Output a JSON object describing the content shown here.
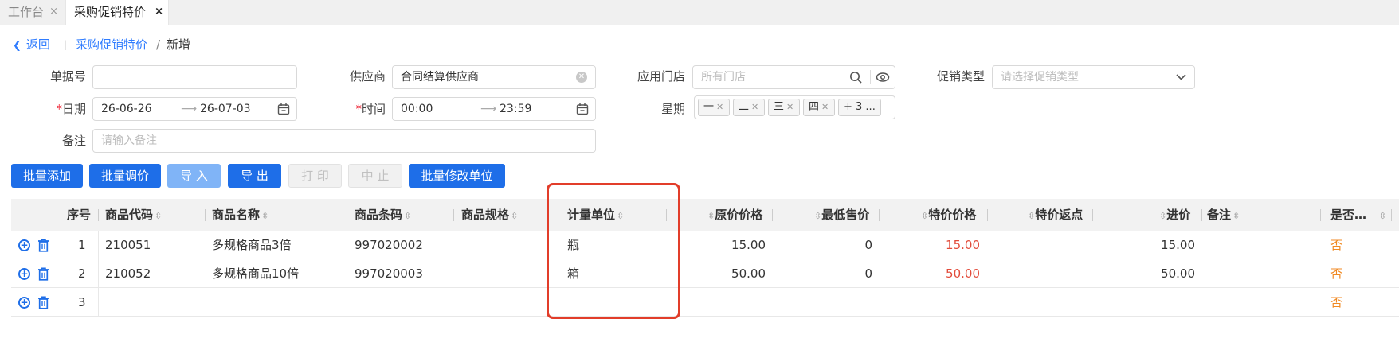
{
  "tabs": [
    {
      "label": "工作台",
      "close": "×"
    },
    {
      "label": "采购促销特价",
      "close": "×"
    }
  ],
  "breadcrumb": {
    "back": "返回",
    "sep": "|",
    "parent": "采购促销特价",
    "slash": "/",
    "current": "新增"
  },
  "form": {
    "doc_no": {
      "label": "单据号",
      "value": ""
    },
    "supplier": {
      "label": "供应商",
      "value": "合同结算供应商"
    },
    "store": {
      "label": "应用门店",
      "placeholder": "所有门店"
    },
    "promo_type": {
      "label": "促销类型",
      "placeholder": "请选择促销类型"
    },
    "date": {
      "required": "*",
      "label": "日期",
      "from": "26-06-26",
      "to": "26-07-03"
    },
    "time": {
      "required": "*",
      "label": "时间",
      "from": "00:00",
      "to": "23:59"
    },
    "weekday": {
      "label": "星期",
      "tags": [
        "一",
        "二",
        "三",
        "四"
      ],
      "more": "+ 3 ..."
    },
    "remark": {
      "label": "备注",
      "placeholder": "请输入备注"
    }
  },
  "buttons": {
    "batch_add": "批量添加",
    "batch_price": "批量调价",
    "import": "导 入",
    "export": "导 出",
    "print": "打 印",
    "stop": "中 止",
    "batch_unit": "批量修改单位"
  },
  "table": {
    "headers": {
      "seq": "序号",
      "code": "商品代码",
      "name": "商品名称",
      "barcode": "商品条码",
      "spec": "商品规格",
      "unit": "计量单位",
      "orig_price": "原价价格",
      "min_price": "最低售价",
      "special_price": "特价价格",
      "rebate": "特价返点",
      "cost": "进价",
      "note": "备注",
      "flag": "是否…"
    },
    "rows": [
      {
        "seq": "1",
        "code": "210051",
        "name": "多规格商品3倍",
        "barcode": "997020002",
        "spec": "",
        "unit": "瓶",
        "orig_price": "15.00",
        "min_price": "0",
        "special_price": "15.00",
        "rebate": "",
        "cost": "15.00",
        "note": "",
        "flag": "否"
      },
      {
        "seq": "2",
        "code": "210052",
        "name": "多规格商品10倍",
        "barcode": "997020003",
        "spec": "",
        "unit": "箱",
        "orig_price": "50.00",
        "min_price": "0",
        "special_price": "50.00",
        "rebate": "",
        "cost": "50.00",
        "note": "",
        "flag": "否"
      },
      {
        "seq": "3",
        "code": "",
        "name": "",
        "barcode": "",
        "spec": "",
        "unit": "",
        "orig_price": "",
        "min_price": "",
        "special_price": "",
        "rebate": "",
        "cost": "",
        "note": "",
        "flag": "否"
      }
    ]
  },
  "colors": {
    "primary": "#1e6ee8",
    "link": "#2f7cff",
    "required": "#e22233",
    "special_price": "#e24b3a",
    "flag": "#f08a24",
    "highlight": "#e23d2a"
  }
}
